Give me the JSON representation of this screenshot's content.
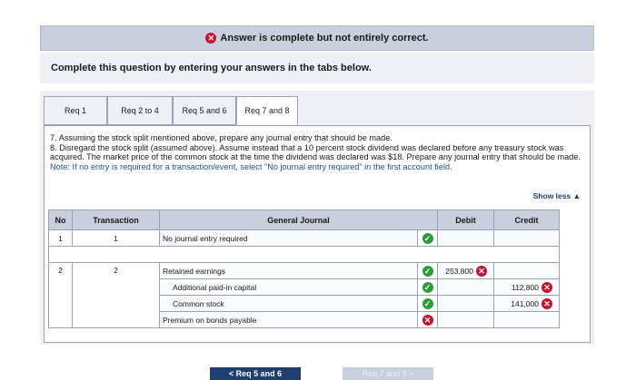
{
  "banner": {
    "message": "Answer is complete but not entirely correct."
  },
  "instructions": "Complete this question by entering your answers in the tabs below.",
  "tabs": [
    {
      "label": "Req 1"
    },
    {
      "label": "Req 2 to 4"
    },
    {
      "label": "Req 5 and 6"
    },
    {
      "label": "Req 7 and 8"
    }
  ],
  "question": {
    "line1": "7. Assuming the stock split mentioned above, prepare any journal entry that should be made.",
    "line2": "8. Disregard the stock split (assumed above). Assume instead that a 10 percent stock dividend was declared before any treasury stock was acquired. The market price of the common stock at the time the dividend was declared was $18. Prepare any journal entry that should be made.",
    "note": "Note: If no entry is required for a transaction/event, select \"No journal entry required\" in the first account field."
  },
  "show_less": "Show less ▲",
  "table": {
    "headers": {
      "no": "No",
      "transaction": "Transaction",
      "journal": "General Journal",
      "debit": "Debit",
      "credit": "Credit"
    },
    "entry1": {
      "no": "1",
      "transaction": "1",
      "account": "No journal entry required"
    },
    "entry2": {
      "no": "2",
      "transaction": "2",
      "rows": [
        {
          "account": "Retained earnings",
          "debit": "253,800",
          "credit": ""
        },
        {
          "account": "Additional paid-in capital",
          "debit": "",
          "credit": "112,800"
        },
        {
          "account": "Common stock",
          "debit": "",
          "credit": "141,000"
        },
        {
          "account": "Premium on bonds payable",
          "debit": "",
          "credit": ""
        }
      ]
    }
  },
  "nav": {
    "prev": "< Req 5 and 6",
    "next": "Req 7 and 8 >"
  },
  "colors": {
    "correct": "#2a9d38",
    "incorrect": "#c8102e",
    "header_bg": "#c9cfdc",
    "nav_active": "#1d3f72"
  }
}
